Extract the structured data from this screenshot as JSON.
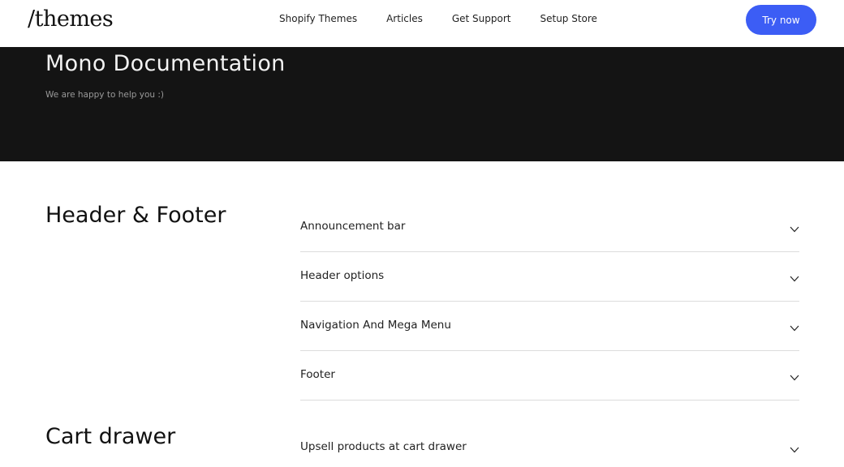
{
  "header": {
    "logo": "/themes",
    "nav": [
      "Shopify Themes",
      "Articles",
      "Get Support",
      "Setup Store"
    ],
    "cta_label": "Try now"
  },
  "hero": {
    "title": "Mono Documentation",
    "subtitle": "We are happy to help you :)"
  },
  "sections": [
    {
      "title": "Header & Footer",
      "items": [
        "Announcement bar",
        "Header options",
        "Navigation And Mega Menu",
        "Footer"
      ]
    },
    {
      "title": "Cart drawer",
      "items": [
        "Upsell products at cart drawer"
      ]
    }
  ],
  "colors": {
    "accent": "#3c5df5",
    "hero_bg": "#141414",
    "divider": "#dcdcdc"
  },
  "icons": {
    "accordion_toggle": "chevron-down-icon"
  }
}
